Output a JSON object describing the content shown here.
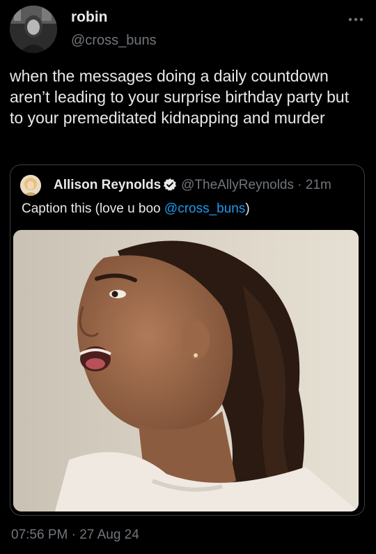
{
  "author": {
    "name": "robin",
    "handle": "@cross_buns",
    "avatar_icon": "profile-photo"
  },
  "more_icon": "more-horizontal-icon",
  "tweet": {
    "text": "when the messages doing a daily countdown aren’t leading to your surprise birthday party but to your premeditated kidnapping and murder"
  },
  "quoted": {
    "name": "Allison Reynolds",
    "verified_icon": "verified-badge-icon",
    "handle": "@TheAllyReynolds",
    "separator": "·",
    "time": "21m",
    "text_before": "Caption this (love u boo ",
    "mention": "@cross_buns",
    "text_after": ")",
    "media_icon": "photo-shocked-woman"
  },
  "footer": {
    "time": "07:56 PM",
    "separator": "·",
    "date": "27 Aug 24"
  },
  "colors": {
    "background": "#000000",
    "text": "#e7e9ea",
    "secondary": "#71767b",
    "link": "#1d9bf0",
    "border": "#3a3d41"
  }
}
